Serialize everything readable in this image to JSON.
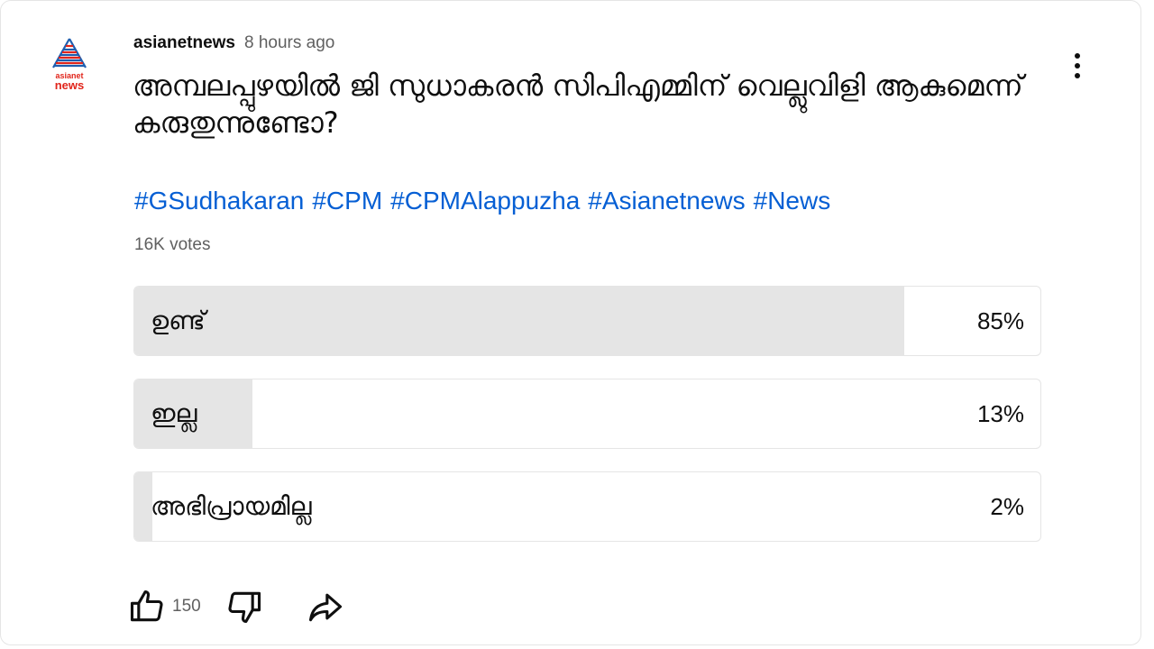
{
  "post": {
    "channel": "asianetnews",
    "time": "8 hours ago",
    "avatar_text_top": "asianet",
    "avatar_text_bottom": "news",
    "question": "അമ്പലപ്പുഴയിൽ ജി സുധാകരൻ സിപിഎമ്മിന് വെല്ലുവിളി ആകുമെന്ന് കരുതുന്നുണ്ടോ?",
    "hashtags": [
      "#GSudhakaran",
      "#CPM",
      "#CPMAlappuzha",
      "#Asianetnews",
      "#News"
    ],
    "votes": "16K votes"
  },
  "poll": {
    "options": [
      {
        "label": "ഉണ്ട്",
        "percent_text": "85%",
        "percent": 85
      },
      {
        "label": "ഇല്ല",
        "percent_text": "13%",
        "percent": 13
      },
      {
        "label": "അഭിപ്രായമില്ല",
        "percent_text": "2%",
        "percent": 2
      }
    ]
  },
  "actions": {
    "like_count": "150",
    "like_icon": "thumbs-up-icon",
    "dislike_icon": "thumbs-down-icon",
    "share_icon": "share-icon",
    "menu_icon": "more-vert-icon"
  },
  "colors": {
    "link": "#065fd4",
    "bar_fill": "#e5e5e5",
    "logo_blue": "#1f5fb0",
    "logo_red": "#e1251b"
  }
}
